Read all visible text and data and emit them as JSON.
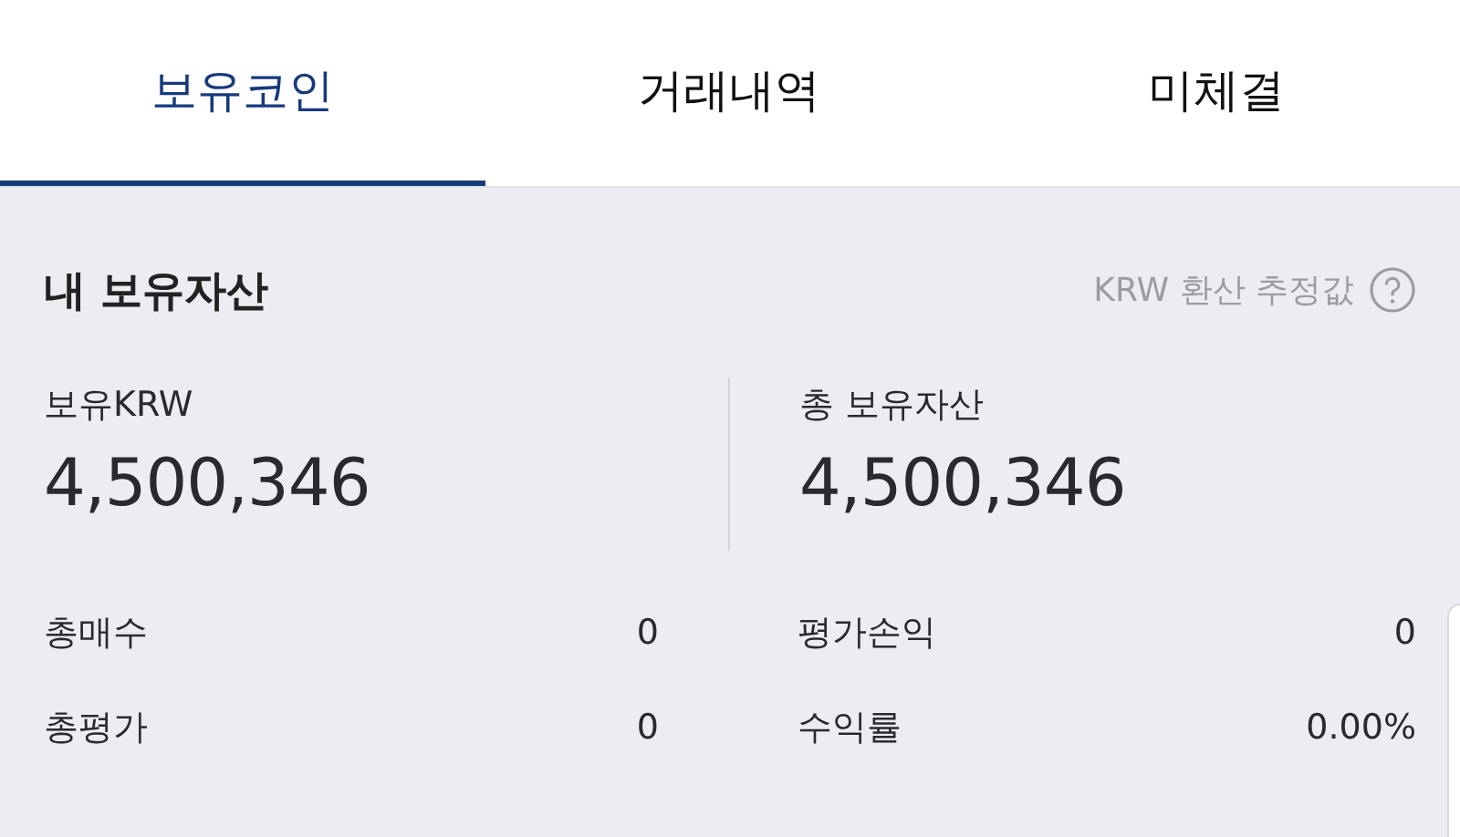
{
  "tabs": [
    {
      "label": "보유코인",
      "selected": true
    },
    {
      "label": "거래내역",
      "selected": false
    },
    {
      "label": "미체결",
      "selected": false
    }
  ],
  "assets": {
    "title": "내 보유자산",
    "note": "KRW 환산 추정값",
    "summary": [
      {
        "label": "보유KRW",
        "value": "4,500,346"
      },
      {
        "label": "총 보유자산",
        "value": "4,500,346"
      }
    ],
    "stats": [
      {
        "label": "총매수",
        "value": "0"
      },
      {
        "label": "평가손익",
        "value": "0"
      },
      {
        "label": "총평가",
        "value": "0"
      },
      {
        "label": "수익률",
        "value": "0.00%"
      }
    ]
  }
}
